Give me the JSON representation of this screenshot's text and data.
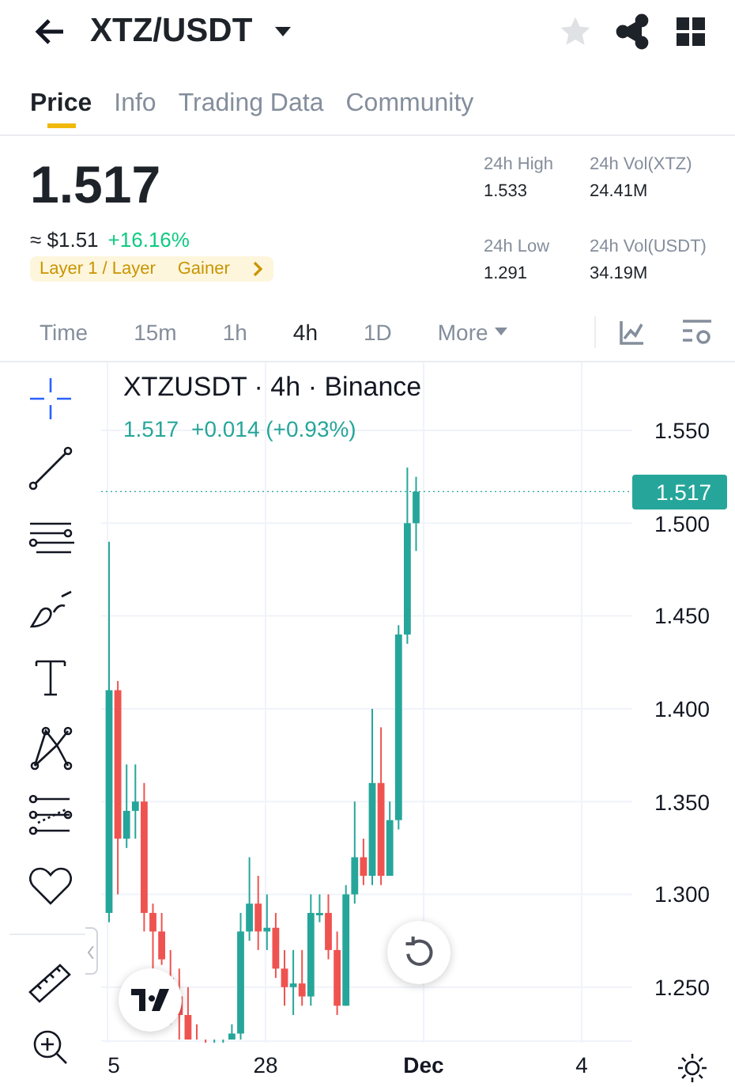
{
  "header": {
    "title": "XTZ/USDT",
    "favorite": false
  },
  "tabs": [
    {
      "label": "Price",
      "selected": true
    },
    {
      "label": "Info",
      "selected": false
    },
    {
      "label": "Trading Data",
      "selected": false
    },
    {
      "label": "Community",
      "selected": false
    }
  ],
  "price": {
    "last": "1.517",
    "fiat": "≈ $1.51",
    "change": "+16.16%",
    "tags": [
      "Layer 1 / Layer",
      "Gainer"
    ]
  },
  "stats": [
    {
      "label": "24h High",
      "value": "1.533"
    },
    {
      "label": "24h Vol(XTZ)",
      "value": "24.41M"
    },
    {
      "label": "24h Low",
      "value": "1.291"
    },
    {
      "label": "24h Vol(USDT)",
      "value": "34.19M"
    }
  ],
  "intervals": [
    {
      "label": "Time",
      "selected": false
    },
    {
      "label": "15m",
      "selected": false
    },
    {
      "label": "1h",
      "selected": false
    },
    {
      "label": "4h",
      "selected": true
    },
    {
      "label": "1D",
      "selected": false
    },
    {
      "label": "More",
      "selected": false
    }
  ],
  "chart": {
    "title": "XTZUSDT · 4h · Binance",
    "quote": "1.517",
    "quote_change": "+0.014 (+0.93%)",
    "price_tag": "1.517",
    "y_labels": [
      "1.550",
      "1.500",
      "1.450",
      "1.400",
      "1.350",
      "1.300",
      "1.250"
    ],
    "x_labels": [
      {
        "label": "5",
        "bold": false
      },
      {
        "label": "28",
        "bold": false
      },
      {
        "label": "Dec",
        "bold": true
      },
      {
        "label": "4",
        "bold": false
      }
    ]
  }
}
